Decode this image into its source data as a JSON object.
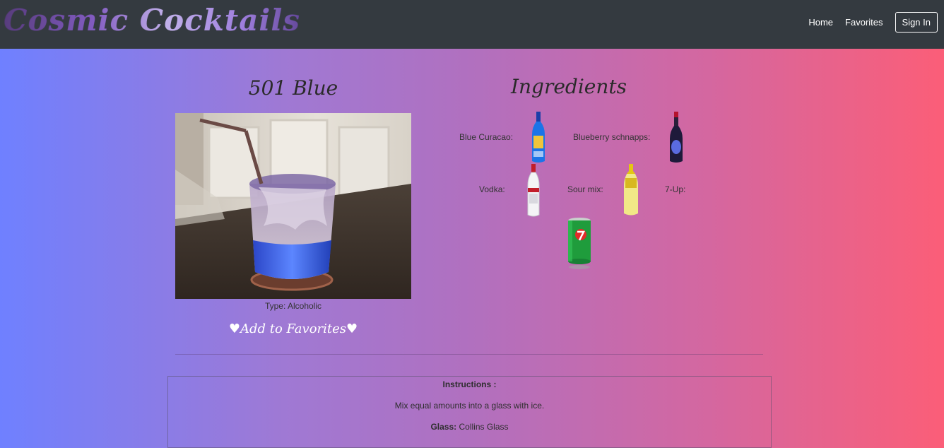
{
  "navbar": {
    "brand": "Cosmic Cocktails",
    "links": {
      "home": "Home",
      "favorites": "Favorites"
    },
    "sign_in": "Sign In"
  },
  "drink": {
    "name": "501 Blue",
    "type_text": "Type: Alcoholic",
    "add_favorites": "♥Add to Favorites♥"
  },
  "ingredients": {
    "heading": "Ingredients",
    "items": [
      {
        "name": "Blue Curacao:",
        "icon": "blue-curacao-bottle"
      },
      {
        "name": "Blueberry schnapps:",
        "icon": "blueberry-schnapps-bottle"
      },
      {
        "name": "Vodka:",
        "icon": "vodka-bottle"
      },
      {
        "name": "Sour mix:",
        "icon": "sour-mix-bottle"
      },
      {
        "name": "7-Up:",
        "icon": "7up-can"
      }
    ]
  },
  "instructions": {
    "heading": "Instructions :",
    "text": "Mix equal amounts into a glass with ice.",
    "glass_label": "Glass:",
    "glass_value": "Collins Glass"
  }
}
